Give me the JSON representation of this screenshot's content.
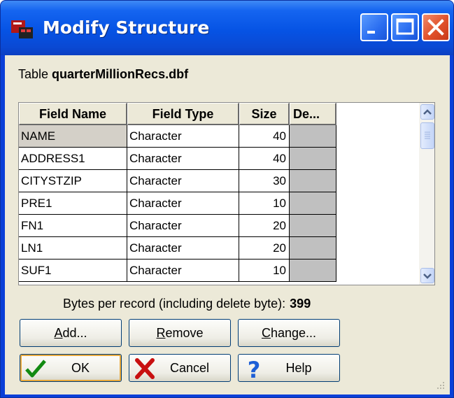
{
  "window": {
    "title": "Modify Structure",
    "accent": "#0a3fd8"
  },
  "table": {
    "prefix": "Table",
    "name": "quarterMillionRecs.dbf"
  },
  "grid": {
    "columns": [
      "Field Name",
      "Field Type",
      "Size",
      "De..."
    ],
    "rows": [
      {
        "name": "NAME",
        "type": "Character",
        "size": "40"
      },
      {
        "name": "ADDRESS1",
        "type": "Character",
        "size": "40"
      },
      {
        "name": "CITYSTZIP",
        "type": "Character",
        "size": "30"
      },
      {
        "name": "PRE1",
        "type": "Character",
        "size": "10"
      },
      {
        "name": "FN1",
        "type": "Character",
        "size": "20"
      },
      {
        "name": "LN1",
        "type": "Character",
        "size": "20"
      },
      {
        "name": "SUF1",
        "type": "Character",
        "size": "10"
      }
    ]
  },
  "summary": {
    "label": "Bytes per record (including delete byte):",
    "value": "399"
  },
  "buttons": {
    "add": {
      "access": "A",
      "rest": "dd..."
    },
    "remove": {
      "access": "R",
      "rest": "emove"
    },
    "change": {
      "access": "C",
      "rest": "hange..."
    },
    "ok": {
      "label": "OK",
      "icon": "check-icon"
    },
    "cancel": {
      "label": "Cancel",
      "icon": "x-icon"
    },
    "help": {
      "label": "Help",
      "icon": "question-icon"
    }
  }
}
